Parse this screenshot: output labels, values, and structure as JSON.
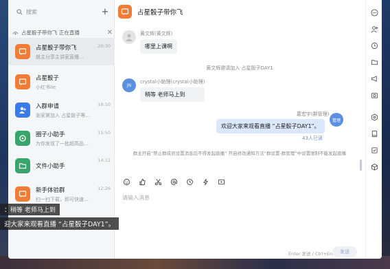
{
  "search": {
    "placeholder": "搜索"
  },
  "live_notice": {
    "text": "占星骰子带你飞 正在直播"
  },
  "conversations": [
    {
      "name": "占星骰子带你飞",
      "preview": "就主分享主讲家直播…",
      "time": "20:30",
      "avatar_color": "#f07c35"
    },
    {
      "name": "占星骰子",
      "preview": "小红书ile",
      "time": "",
      "avatar_color": "#f07c35"
    },
    {
      "name": "入群申请",
      "preview": "张家第加入 占星骰子等…",
      "time": "18:10",
      "avatar_color": "#3b7be8"
    },
    {
      "name": "圈子小助手",
      "preview": "为你发现了一批超高品…",
      "time": "15:50",
      "avatar_color": "#3aa46d"
    },
    {
      "name": "文件小助手",
      "preview": "",
      "time": "14:12",
      "avatar_color": "#3aa46d"
    },
    {
      "name": "新手体验群",
      "preview": "扫一扫下载，即可快速…",
      "time": "12:26",
      "avatar_color": "#f07c35"
    }
  ],
  "chat": {
    "title": "占星骰子带你飞",
    "messages": [
      {
        "sender": "黄文辉(黄文辉)",
        "text": "哪里上课啊",
        "avatar_label": ""
      },
      {
        "sender": "crystal小助理(crystal小助理)",
        "text": "稍等 老师马上到",
        "avatar_label": "JN"
      }
    ],
    "system_1": "黄文辉邀请加入 占星骰子DAY1",
    "my_message": {
      "sender": "葛宏宇(群管理)",
      "text": "欢迎大家来观看直播 “占星骰子DAY1”。",
      "read_status": "43人已读",
      "avatar_label": "管理"
    },
    "system_2": "群主开启“禁止群成员设置消息后不得发起直播” 开启修改通知方法“群设置-群管理”中设置限制不能发起直播",
    "input_placeholder": "请输入消息",
    "send_hint": "Enter 发送 / Ctrl+Enter 换行",
    "send_label": "发送"
  },
  "toolbar_icons": [
    "emoji-icon",
    "thumbs-up-icon",
    "scissors-icon",
    "at-icon",
    "history-icon",
    "lightning-icon",
    "video-icon"
  ],
  "right_rail_icons": [
    "more-icon",
    "add-member-icon",
    "clock-icon",
    "folder-icon",
    "announcement-icon",
    "camera-icon",
    "settings-icon",
    "tablet-icon",
    "task-icon",
    "box-icon"
  ],
  "captions": {
    "line1": "：稍等 老师马上到",
    "line2": "迎大家来观看直播 “占星骰子DAY1”。"
  }
}
